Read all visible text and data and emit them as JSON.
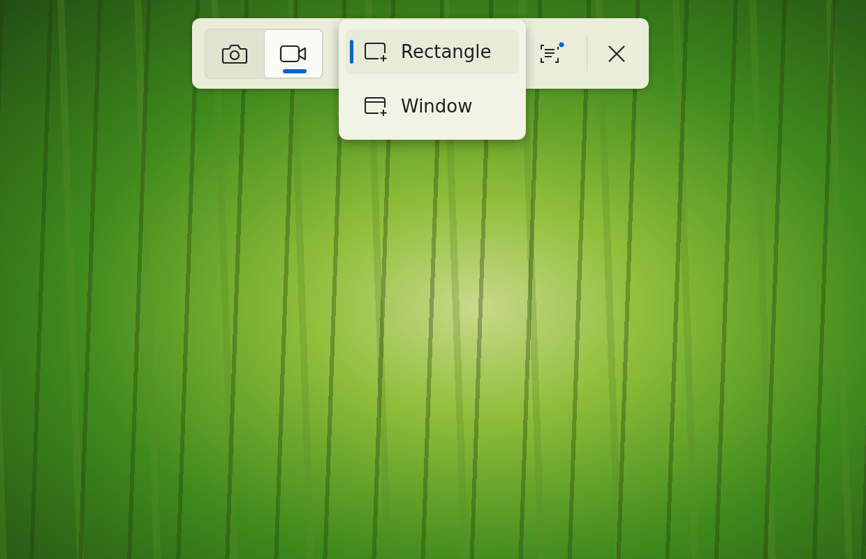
{
  "capture_modes": [
    {
      "kind": "photo",
      "selected": false
    },
    {
      "kind": "video",
      "selected": true
    }
  ],
  "area_menu": {
    "items": [
      {
        "kind": "rectangle",
        "label": "Rectangle",
        "selected": true
      },
      {
        "kind": "window",
        "label": "Window",
        "selected": false
      }
    ]
  },
  "text_actions": {
    "notification_dot": true
  }
}
